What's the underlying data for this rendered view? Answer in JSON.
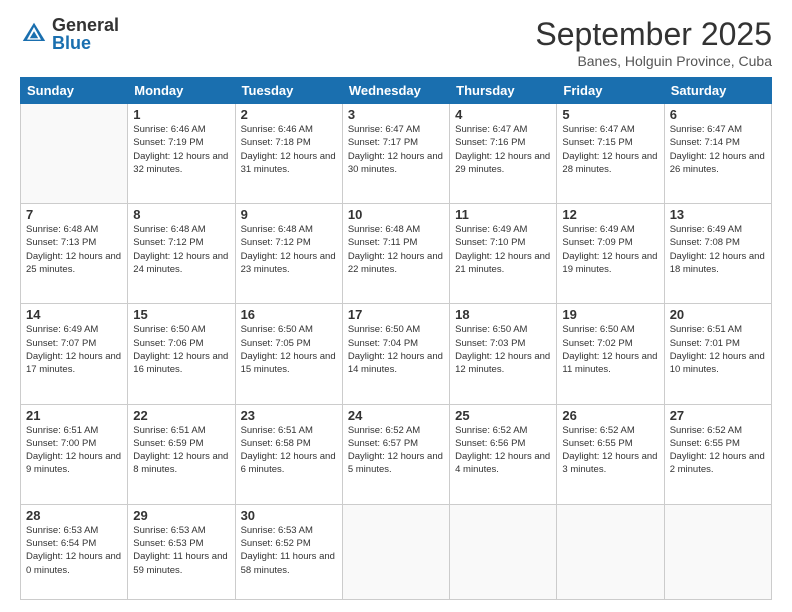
{
  "logo": {
    "general": "General",
    "blue": "Blue"
  },
  "title": "September 2025",
  "location": "Banes, Holguin Province, Cuba",
  "days_of_week": [
    "Sunday",
    "Monday",
    "Tuesday",
    "Wednesday",
    "Thursday",
    "Friday",
    "Saturday"
  ],
  "weeks": [
    [
      {
        "day": "",
        "info": ""
      },
      {
        "day": "1",
        "info": "Sunrise: 6:46 AM\nSunset: 7:19 PM\nDaylight: 12 hours\nand 32 minutes."
      },
      {
        "day": "2",
        "info": "Sunrise: 6:46 AM\nSunset: 7:18 PM\nDaylight: 12 hours\nand 31 minutes."
      },
      {
        "day": "3",
        "info": "Sunrise: 6:47 AM\nSunset: 7:17 PM\nDaylight: 12 hours\nand 30 minutes."
      },
      {
        "day": "4",
        "info": "Sunrise: 6:47 AM\nSunset: 7:16 PM\nDaylight: 12 hours\nand 29 minutes."
      },
      {
        "day": "5",
        "info": "Sunrise: 6:47 AM\nSunset: 7:15 PM\nDaylight: 12 hours\nand 28 minutes."
      },
      {
        "day": "6",
        "info": "Sunrise: 6:47 AM\nSunset: 7:14 PM\nDaylight: 12 hours\nand 26 minutes."
      }
    ],
    [
      {
        "day": "7",
        "info": "Sunrise: 6:48 AM\nSunset: 7:13 PM\nDaylight: 12 hours\nand 25 minutes."
      },
      {
        "day": "8",
        "info": "Sunrise: 6:48 AM\nSunset: 7:12 PM\nDaylight: 12 hours\nand 24 minutes."
      },
      {
        "day": "9",
        "info": "Sunrise: 6:48 AM\nSunset: 7:12 PM\nDaylight: 12 hours\nand 23 minutes."
      },
      {
        "day": "10",
        "info": "Sunrise: 6:48 AM\nSunset: 7:11 PM\nDaylight: 12 hours\nand 22 minutes."
      },
      {
        "day": "11",
        "info": "Sunrise: 6:49 AM\nSunset: 7:10 PM\nDaylight: 12 hours\nand 21 minutes."
      },
      {
        "day": "12",
        "info": "Sunrise: 6:49 AM\nSunset: 7:09 PM\nDaylight: 12 hours\nand 19 minutes."
      },
      {
        "day": "13",
        "info": "Sunrise: 6:49 AM\nSunset: 7:08 PM\nDaylight: 12 hours\nand 18 minutes."
      }
    ],
    [
      {
        "day": "14",
        "info": "Sunrise: 6:49 AM\nSunset: 7:07 PM\nDaylight: 12 hours\nand 17 minutes."
      },
      {
        "day": "15",
        "info": "Sunrise: 6:50 AM\nSunset: 7:06 PM\nDaylight: 12 hours\nand 16 minutes."
      },
      {
        "day": "16",
        "info": "Sunrise: 6:50 AM\nSunset: 7:05 PM\nDaylight: 12 hours\nand 15 minutes."
      },
      {
        "day": "17",
        "info": "Sunrise: 6:50 AM\nSunset: 7:04 PM\nDaylight: 12 hours\nand 14 minutes."
      },
      {
        "day": "18",
        "info": "Sunrise: 6:50 AM\nSunset: 7:03 PM\nDaylight: 12 hours\nand 12 minutes."
      },
      {
        "day": "19",
        "info": "Sunrise: 6:50 AM\nSunset: 7:02 PM\nDaylight: 12 hours\nand 11 minutes."
      },
      {
        "day": "20",
        "info": "Sunrise: 6:51 AM\nSunset: 7:01 PM\nDaylight: 12 hours\nand 10 minutes."
      }
    ],
    [
      {
        "day": "21",
        "info": "Sunrise: 6:51 AM\nSunset: 7:00 PM\nDaylight: 12 hours\nand 9 minutes."
      },
      {
        "day": "22",
        "info": "Sunrise: 6:51 AM\nSunset: 6:59 PM\nDaylight: 12 hours\nand 8 minutes."
      },
      {
        "day": "23",
        "info": "Sunrise: 6:51 AM\nSunset: 6:58 PM\nDaylight: 12 hours\nand 6 minutes."
      },
      {
        "day": "24",
        "info": "Sunrise: 6:52 AM\nSunset: 6:57 PM\nDaylight: 12 hours\nand 5 minutes."
      },
      {
        "day": "25",
        "info": "Sunrise: 6:52 AM\nSunset: 6:56 PM\nDaylight: 12 hours\nand 4 minutes."
      },
      {
        "day": "26",
        "info": "Sunrise: 6:52 AM\nSunset: 6:55 PM\nDaylight: 12 hours\nand 3 minutes."
      },
      {
        "day": "27",
        "info": "Sunrise: 6:52 AM\nSunset: 6:55 PM\nDaylight: 12 hours\nand 2 minutes."
      }
    ],
    [
      {
        "day": "28",
        "info": "Sunrise: 6:53 AM\nSunset: 6:54 PM\nDaylight: 12 hours\nand 0 minutes."
      },
      {
        "day": "29",
        "info": "Sunrise: 6:53 AM\nSunset: 6:53 PM\nDaylight: 11 hours\nand 59 minutes."
      },
      {
        "day": "30",
        "info": "Sunrise: 6:53 AM\nSunset: 6:52 PM\nDaylight: 11 hours\nand 58 minutes."
      },
      {
        "day": "",
        "info": ""
      },
      {
        "day": "",
        "info": ""
      },
      {
        "day": "",
        "info": ""
      },
      {
        "day": "",
        "info": ""
      }
    ]
  ]
}
